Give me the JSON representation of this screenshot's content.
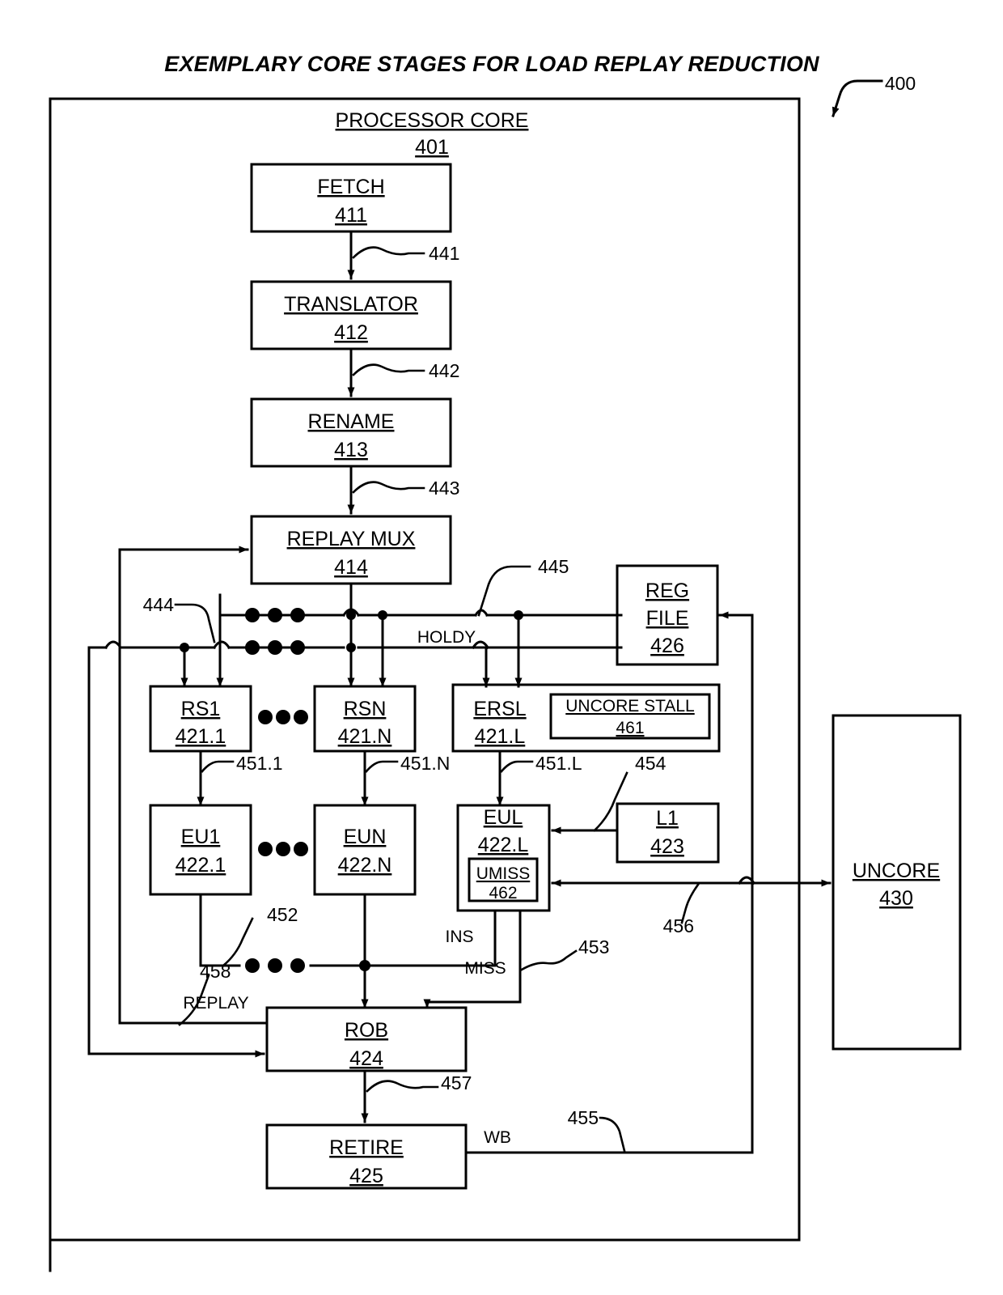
{
  "figure": {
    "title": "EXEMPLARY CORE STAGES FOR LOAD REPLAY REDUCTION",
    "figure_ref": "400",
    "outer_label": "PROCESSOR CORE",
    "outer_ref": "401"
  },
  "blocks": {
    "fetch": {
      "label": "FETCH",
      "ref": "411"
    },
    "translator": {
      "label": "TRANSLATOR",
      "ref": "412"
    },
    "rename": {
      "label": "RENAME",
      "ref": "413"
    },
    "replay_mux": {
      "label": "REPLAY MUX",
      "ref": "414"
    },
    "rs1": {
      "label": "RS1",
      "ref": "421.1"
    },
    "rsn": {
      "label": "RSN",
      "ref": "421.N"
    },
    "ersl": {
      "label": "ERSL",
      "ref": "421.L"
    },
    "uncore_stall": {
      "label": "UNCORE STALL",
      "ref": "461"
    },
    "eu1": {
      "label": "EU1",
      "ref": "422.1"
    },
    "eun": {
      "label": "EUN",
      "ref": "422.N"
    },
    "eul": {
      "label": "EUL",
      "ref": "422.L"
    },
    "umiss": {
      "label": "UMISS",
      "ref": "462"
    },
    "l1": {
      "label": "L1",
      "ref": "423"
    },
    "rob": {
      "label": "ROB",
      "ref": "424"
    },
    "retire": {
      "label": "RETIRE",
      "ref": "425"
    },
    "reg_file_1": {
      "label": "REG",
      "label2": "FILE",
      "ref": "426"
    },
    "uncore": {
      "label": "UNCORE",
      "ref": "430"
    }
  },
  "refs": {
    "r441": "441",
    "r442": "442",
    "r443": "443",
    "r444": "444",
    "r445": "445",
    "r451_1": "451.1",
    "r451_n": "451.N",
    "r451_l": "451.L",
    "r452": "452",
    "r453": "453",
    "r454": "454",
    "r455": "455",
    "r456": "456",
    "r457": "457",
    "r458": "458"
  },
  "signals": {
    "holdy": "HOLDY",
    "ins": "INS",
    "miss": "MISS",
    "replay": "REPLAY",
    "wb": "WB"
  },
  "colors": {
    "stroke": "#000000",
    "background": "#ffffff"
  }
}
